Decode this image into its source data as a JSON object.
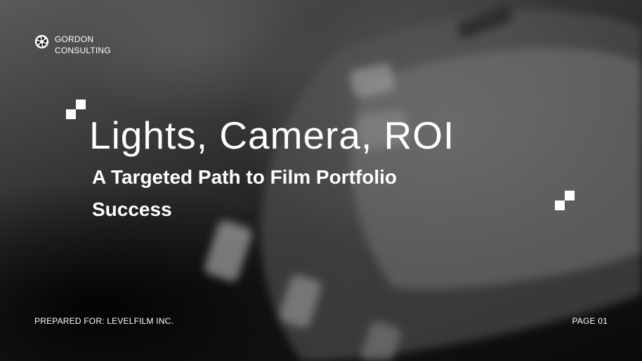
{
  "brand": {
    "name_line1": "GORDON",
    "name_line2": "CONSULTING",
    "logo_icon": "camera-aperture-icon"
  },
  "hero": {
    "title": "Lights, Camera, ROI",
    "subtitle_line1": "A Targeted Path to Film Portfolio",
    "subtitle_line2": "Success"
  },
  "footer": {
    "prepared_for": "PREPARED FOR: LEVELFILM INC.",
    "page": "PAGE 01"
  },
  "colors": {
    "text": "#ffffff",
    "background_dark": "#0b0b0b",
    "background_light": "#5a5a5a"
  }
}
